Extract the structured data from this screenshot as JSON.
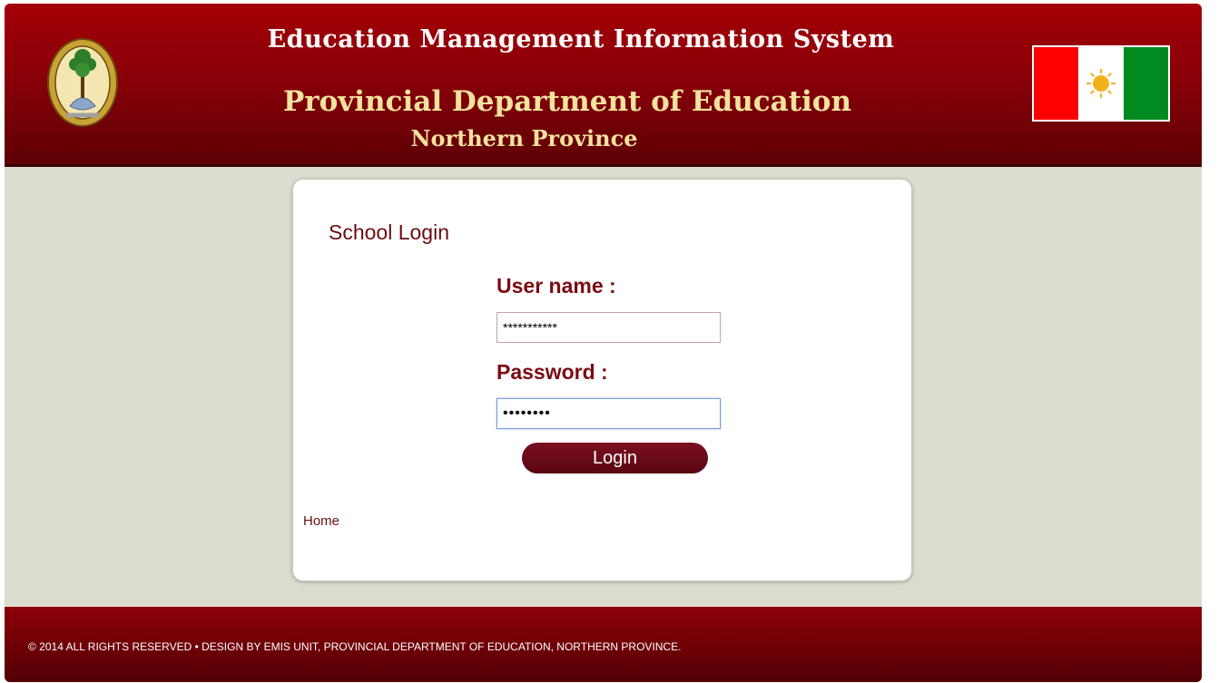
{
  "header": {
    "title": "Education Management Information System",
    "department": "Provincial Department of Education",
    "province": "Northern Province",
    "emblem_icon": "provincial-emblem-icon",
    "flag_icon": "provincial-flag-icon",
    "colors": {
      "header_bg": "#8a0008",
      "title_text": "#ffffff",
      "subtitle_text": "#f2e29e"
    }
  },
  "login": {
    "heading": "School Login",
    "username_label": "User name :",
    "username_value": "***********",
    "password_label": "Password :",
    "password_value": "••••••••",
    "login_button": "Login",
    "home_link": "Home"
  },
  "footer": {
    "copyright_text": "© 2014 ALL RIGHTS RESERVED  •  DESIGN BY EMIS UNIT, PROVINCIAL DEPARTMENT OF EDUCATION, NORTHERN PROVINCE."
  },
  "colors": {
    "accent": "#7a0c12",
    "page_bg": "#dcdccf",
    "button_bg": "#5a0612"
  }
}
